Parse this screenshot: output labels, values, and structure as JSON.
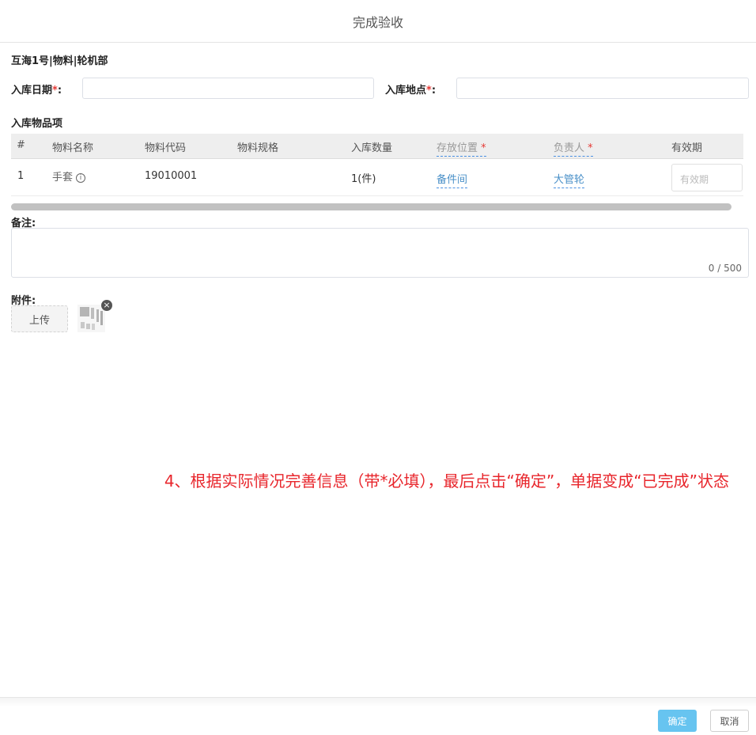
{
  "dialog": {
    "title": "完成验收"
  },
  "ship_label": "互海1号|物料|轮机部",
  "form": {
    "date_label": "入库日期",
    "place_label": "入库地点",
    "required_mark": "*",
    "colon": ":"
  },
  "items": {
    "title": "入库物品项",
    "columns": {
      "index": "#",
      "name": "物料名称",
      "code": "物料代码",
      "spec": "物料规格",
      "quantity": "入库数量",
      "location": "存放位置",
      "person": "负责人",
      "expiry": "有效期"
    },
    "rows": [
      {
        "index": "1",
        "name": "手套",
        "info_icon": "i",
        "code": "19010001",
        "spec": "",
        "quantity": "1(件)",
        "location": "备件间",
        "person": "大管轮",
        "expiry_placeholder": "有效期"
      }
    ]
  },
  "remark": {
    "label": "备注:",
    "counter": "0 / 500"
  },
  "attachment": {
    "label": "附件:",
    "upload_label": "上传",
    "remove_icon": "×"
  },
  "instruction": "4、根据实际情况完善信息（带*必填），最后点击“确定”，单据变成“已完成”状态",
  "footer": {
    "confirm_label": "确定",
    "cancel_label": "取消"
  },
  "colors": {
    "accent": "#67c4f0",
    "link": "#4a90c8",
    "required": "#e53935",
    "instruction": "#e8262c"
  }
}
